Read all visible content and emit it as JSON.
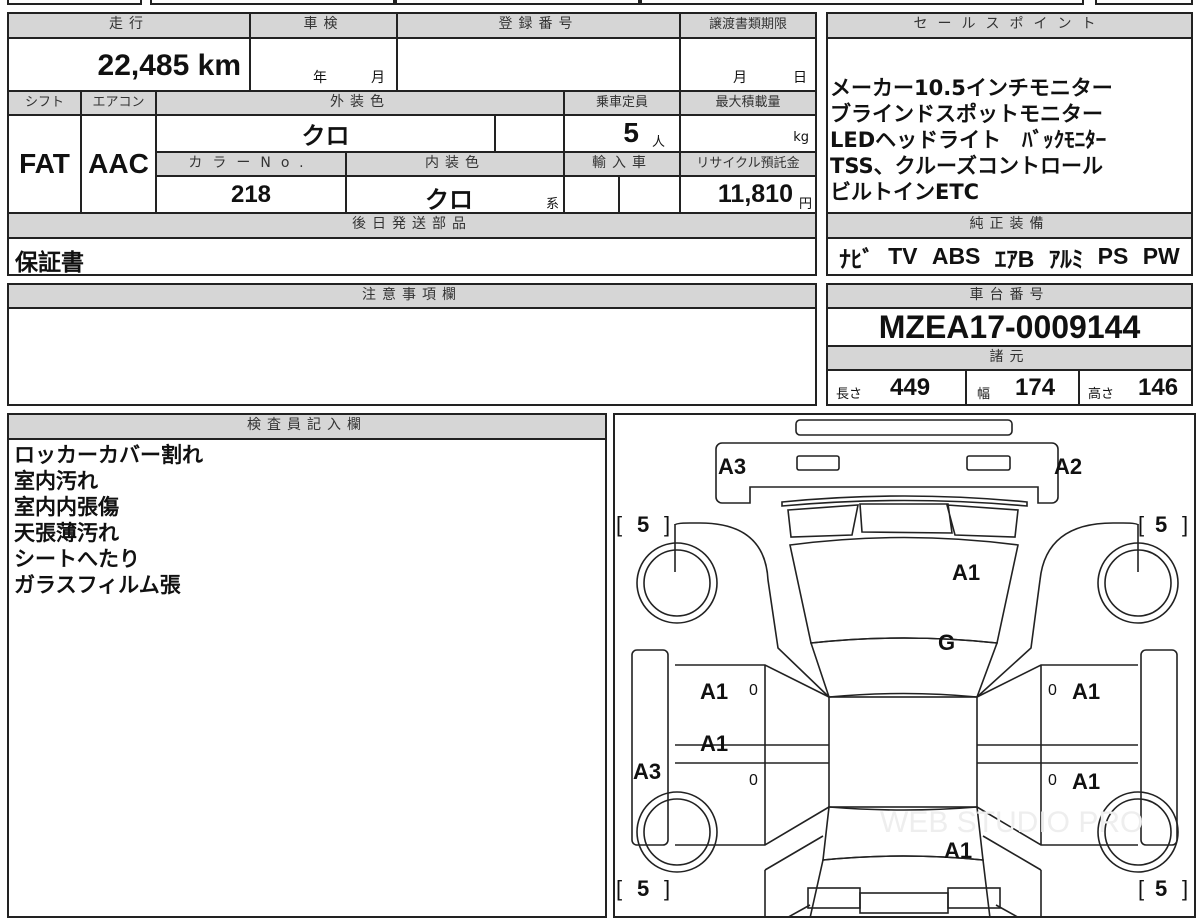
{
  "sheet": {
    "mileage": {
      "label": "走行",
      "value": "22,485",
      "unit": "km"
    },
    "inspection": {
      "label": "車検",
      "year": "年",
      "month": "月"
    },
    "registration": {
      "label": "登録番号",
      "value": ""
    },
    "transfer_deadline": {
      "label": "譲渡書類期限",
      "month": "月",
      "day": "日"
    },
    "shift": {
      "label": "シフト",
      "value": "FAT"
    },
    "aircon": {
      "label": "エアコン",
      "value": "AAC"
    },
    "exterior_color": {
      "label": "外装色",
      "value": "クロ"
    },
    "capacity": {
      "label": "乗車定員",
      "value": "5",
      "unit": "人"
    },
    "max_load": {
      "label": "最大積載量",
      "value": "",
      "unit": "kg"
    },
    "color_no": {
      "label": "カラーNo.",
      "value": "218"
    },
    "interior_color": {
      "label": "内装色",
      "value": "クロ",
      "suffix": "系"
    },
    "import": {
      "label": "輸入車"
    },
    "recycle_fee": {
      "label": "リサイクル預託金",
      "value": "11,810",
      "unit": "円"
    },
    "later_parts": {
      "label": "後日発送部品",
      "value": "保証書"
    },
    "notes": {
      "label": "注意事項欄"
    },
    "sales_points": {
      "label": "セールスポイント",
      "items": [
        "メーカー10.5インチモニター",
        "ブラインドスポットモニター",
        "LEDヘッドライト　ﾊﾞｯｸﾓﾆﾀｰ",
        "TSS、クルーズコントロール",
        "ビルトインETC"
      ]
    },
    "equipment": {
      "label": "純正装備",
      "items": [
        "ﾅﾋﾞ",
        "TV",
        "ABS",
        "ｴｱB",
        "ｱﾙﾐ",
        "PS",
        "PW"
      ]
    },
    "chassis": {
      "label": "車台番号",
      "value": "MZEA17-0009144"
    },
    "specs": {
      "label": "諸元",
      "length": {
        "label": "長さ",
        "value": "449"
      },
      "width": {
        "label": "幅",
        "value": "174"
      },
      "height": {
        "label": "高さ",
        "value": "146"
      }
    },
    "inspector": {
      "label": "検査員記入欄",
      "items": [
        "ロッカーカバー割れ",
        "室内汚れ",
        "室内内張傷",
        "天張薄汚れ",
        "シートへたり",
        "ガラスフィルム張"
      ]
    },
    "diagram": {
      "front_left": "A3",
      "front_right": "A2",
      "hood": "A1",
      "windshield": "G",
      "left_front_door": "A1",
      "left_rear_door": "A1",
      "right_front_door": "A1",
      "right_rear_door": "A1",
      "left_rocker": "A3",
      "trunk": "A1",
      "door_marks": [
        "0",
        "0",
        "0",
        "0"
      ],
      "tires": [
        "5",
        "5",
        "5",
        "5"
      ],
      "watermark": "WEB STUDIO PRO"
    }
  }
}
